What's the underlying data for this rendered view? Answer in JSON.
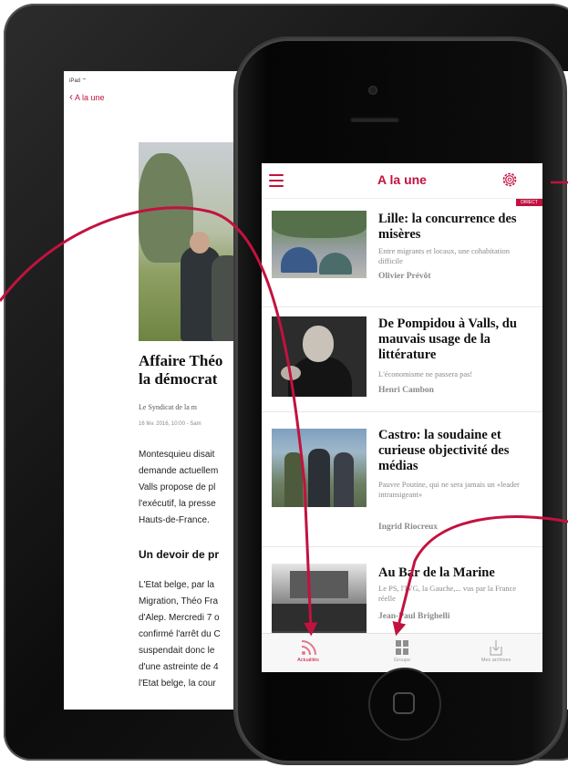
{
  "tablet": {
    "status": "iPad ⌔",
    "back_label": "A la une",
    "article_title_line1": "Affaire Théo",
    "article_title_line2": "la démocrat",
    "author": "Le Syndicat de la m",
    "date": "16 fév. 2016, 10:00 - Sam",
    "body_lines": [
      "Montesquieu disait",
      "demande actuellem",
      "Valls propose de pl",
      "l'exécutif, la presse",
      "Hauts-de-France."
    ],
    "subheading": "Un devoir de pr",
    "body2_lines": [
      "L'Etat belge, par la",
      "Migration, Théo Fra",
      "d'Alep. Mercredi 7 o",
      "confirmé l'arrêt du C",
      "suspendait donc le",
      "d'une astreinte de 4",
      "l'Etat belge, la cour"
    ]
  },
  "phone": {
    "nav_title": "A la une",
    "live_badge": "DIRECT",
    "articles": [
      {
        "title": "Lille: la concurrence des misères",
        "subtitle": "Entre migrants et locaux, une cohabitation difficile",
        "author": "Olivier Prévôt"
      },
      {
        "title": "De Pompidou à Valls, du mauvais usage de la littérature",
        "subtitle": "L'économisme ne passera pas!",
        "author": "Henri Cambon"
      },
      {
        "title": "Castro: la soudaine et curieuse objectivité des médias",
        "subtitle": "Pauvre Poutine, qui ne sera jamais un «leader intransigeant»",
        "author": "Ingrid Riocreux"
      },
      {
        "title": "Au Bar de la Marine",
        "subtitle": "Le PS, l'IVG, la Gauche,... vus par la France réelle",
        "author": "Jean-Paul Brighelli"
      }
    ],
    "tabs": [
      {
        "label": "Actualités",
        "icon": "rss-icon"
      },
      {
        "label": "Groupe",
        "icon": "grid-icon"
      },
      {
        "label": "Mes archives",
        "icon": "download-icon"
      }
    ]
  },
  "colors": {
    "accent": "#c2123f"
  }
}
